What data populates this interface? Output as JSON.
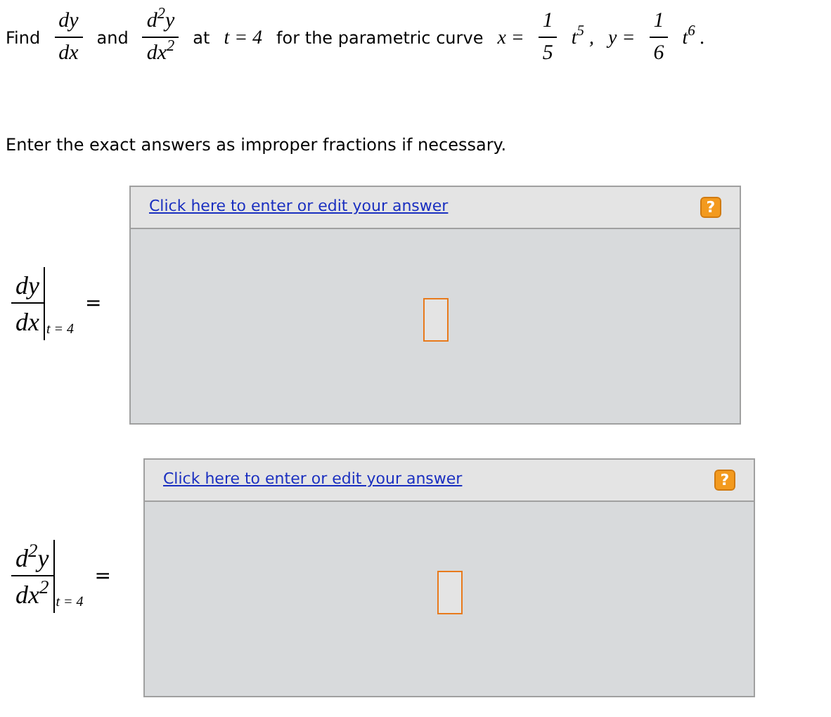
{
  "question": [
    {
      "kind": "text",
      "text": "Find"
    },
    {
      "kind": "frac",
      "num": "dy",
      "den": "dx"
    },
    {
      "kind": "text",
      "text": "and"
    },
    {
      "kind": "frac",
      "num": "d$^{2}$y",
      "den": "dx$^{2}$"
    },
    {
      "kind": "text",
      "text": "at"
    },
    {
      "kind": "math",
      "text": "t = 4"
    },
    {
      "kind": "text",
      "text": "for the parametric curve"
    },
    {
      "kind": "math",
      "text": "x ="
    },
    {
      "kind": "frac",
      "num": "1",
      "den": "5"
    },
    {
      "kind": "math",
      "text": "t$^{5}$ ,"
    },
    {
      "kind": "math",
      "text": "y ="
    },
    {
      "kind": "frac",
      "num": "1",
      "den": "6"
    },
    {
      "kind": "math",
      "text": "t$^{6}$ ."
    }
  ],
  "instruction": "Enter the exact answers as improper fractions if necessary.",
  "answers": [
    {
      "num": "dy",
      "den": "dx",
      "at": "t = 4",
      "eq": "=",
      "link": "Click here to enter or edit your answer",
      "help": "?"
    },
    {
      "num": "d$^{2}$y",
      "den": "dx$^{2}$",
      "at": "t = 4",
      "eq": "=",
      "link": "Click here to enter or edit your answer",
      "help": "?"
    }
  ]
}
